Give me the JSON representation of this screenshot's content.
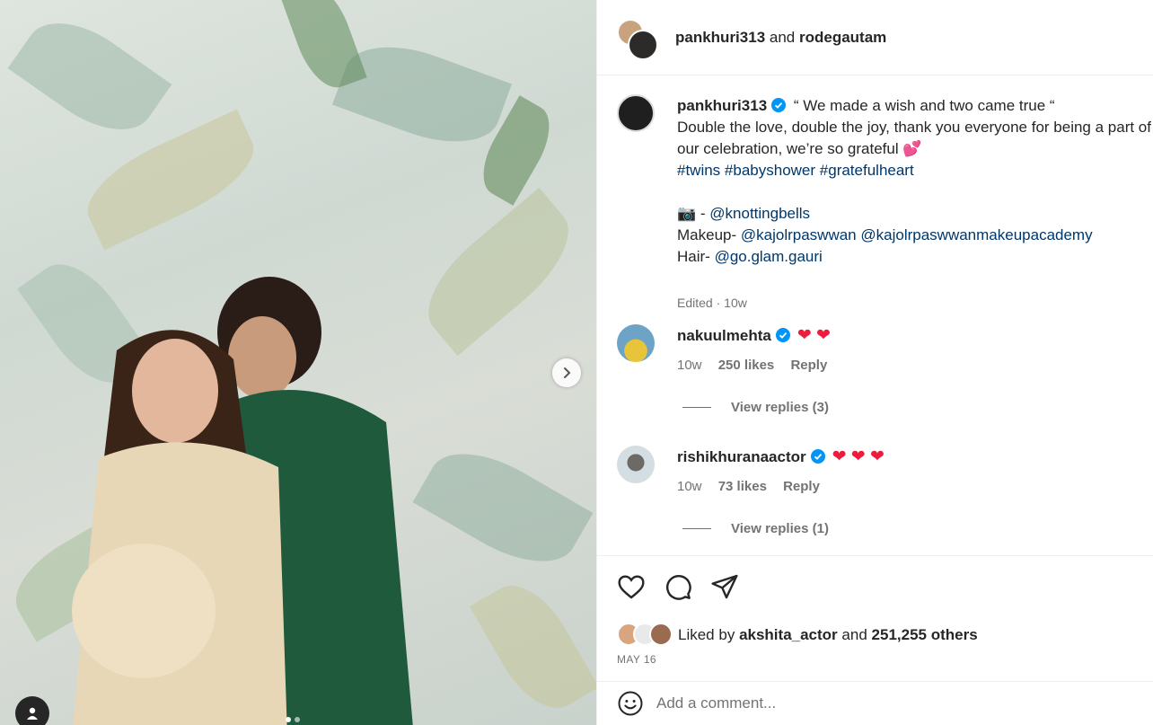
{
  "header": {
    "user1": "pankhuri313",
    "joiner": "and",
    "user2": "rodegautam"
  },
  "caption": {
    "username": "pankhuri313",
    "quote": " “ We made a wish and two came true “",
    "line2": "Double the love, double the joy, thank you everyone for being a part of our celebration, we’re so grateful ",
    "hashtags": [
      "#twins",
      "#babyshower",
      "#gratefulheart"
    ],
    "camera_emoji": "📷",
    "camera_sep": " - ",
    "photographer": "@knottingbells",
    "makeup_label": "Makeup- ",
    "makeup_tags": [
      "@kajolrpaswwan",
      "@kajolrpaswwanmakeupacademy"
    ],
    "hair_label": "Hair- ",
    "hair_tag": "@go.glam.gauri",
    "edited": "Edited",
    "meta_sep": " · ",
    "time": "10w"
  },
  "comments": [
    {
      "username": "nakuulmehta",
      "hearts": "❤ ❤",
      "time": "10w",
      "likes": "250 likes",
      "reply": "Reply",
      "view_replies": "View replies (3)"
    },
    {
      "username": "rishikhuranaactor",
      "hearts": "❤ ❤ ❤",
      "time": "10w",
      "likes": "73 likes",
      "reply": "Reply",
      "view_replies": "View replies (1)"
    }
  ],
  "likes": {
    "prefix": "Liked by",
    "liker": "akshita_actor",
    "joiner": "and",
    "others": "251,255 others"
  },
  "date": "MAY 16",
  "comment_box": {
    "placeholder": "Add a comment..."
  },
  "colors": {
    "link": "#00376b",
    "verified": "#0095f6",
    "heart": "#ed1c3c",
    "secondary_text": "#737373"
  }
}
